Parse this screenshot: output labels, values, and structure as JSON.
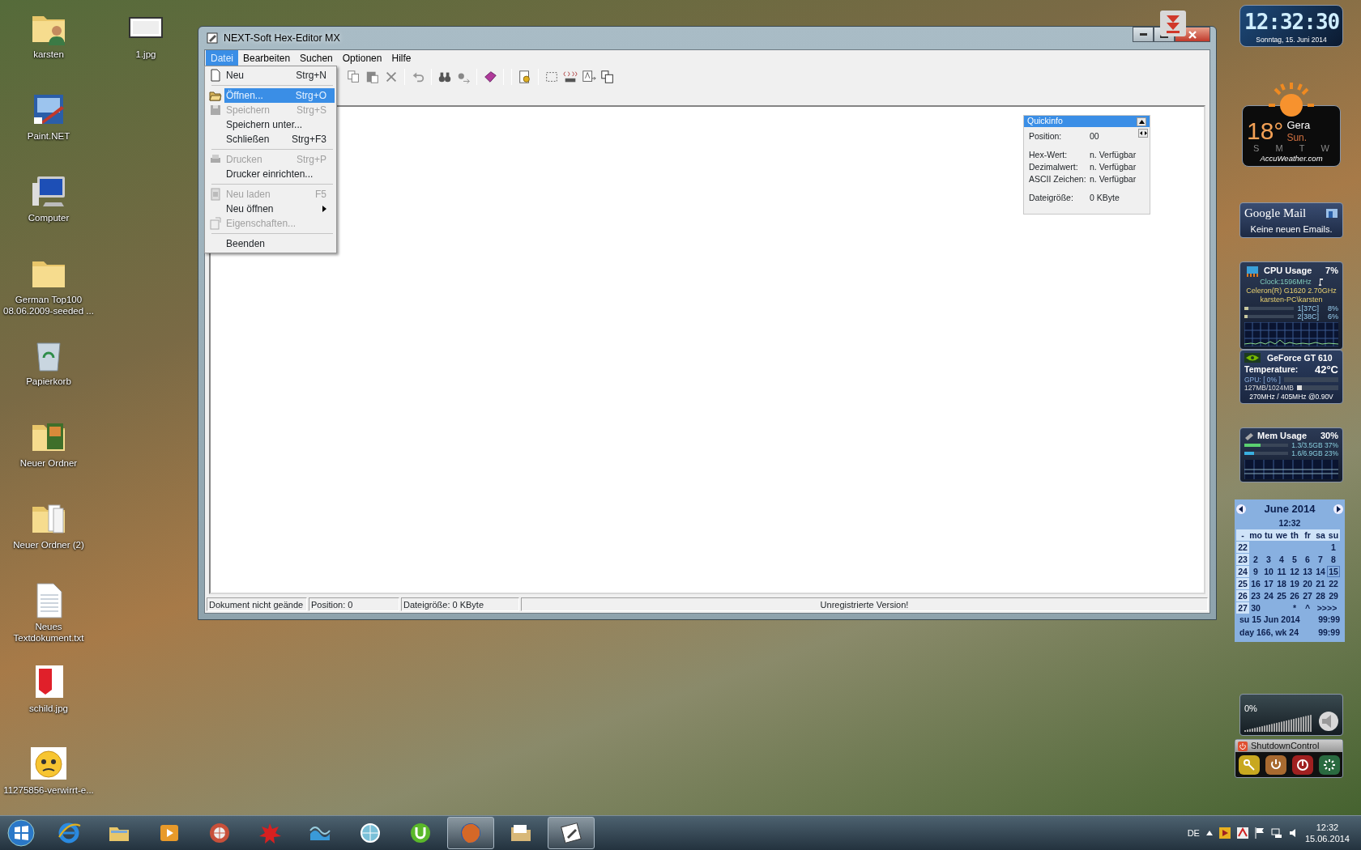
{
  "desktop_icons": [
    {
      "kind": "user-folder",
      "label": "karsten"
    },
    {
      "kind": "paint-app",
      "label": "Paint.NET"
    },
    {
      "kind": "computer",
      "label": "Computer"
    },
    {
      "kind": "folder",
      "label": "German Top100 08.06.2009-seeded ..."
    },
    {
      "kind": "recycle-bin",
      "label": "Papierkorb"
    },
    {
      "kind": "photo-folder",
      "label": "Neuer Ordner"
    },
    {
      "kind": "document-folder",
      "label": "Neuer Ordner (2)"
    },
    {
      "kind": "text-file",
      "label": "Neues Textdokument.txt"
    },
    {
      "kind": "image-file",
      "label": "schild.jpg"
    },
    {
      "kind": "emoji-image",
      "label": "11275856-verwirrt-e..."
    }
  ],
  "desktop_icons_column_2": [
    {
      "kind": "blank-image",
      "label": "1.jpg"
    }
  ],
  "window": {
    "title": "NEXT-Soft Hex-Editor MX",
    "menu": [
      {
        "label": "Datei",
        "selected": true
      },
      {
        "label": "Bearbeiten",
        "selected": false
      },
      {
        "label": "Suchen",
        "selected": false
      },
      {
        "label": "Optionen",
        "selected": false
      },
      {
        "label": "Hilfe",
        "selected": false
      }
    ],
    "file_menu": [
      {
        "kind": "item",
        "label": "Neu",
        "shortcut": "Strg+N",
        "disabled": false,
        "selected": false
      },
      {
        "kind": "separator"
      },
      {
        "kind": "item",
        "label": "Öffnen...",
        "shortcut": "Strg+O",
        "disabled": false,
        "selected": true
      },
      {
        "kind": "item",
        "label": "Speichern",
        "shortcut": "Strg+S",
        "disabled": true,
        "selected": false
      },
      {
        "kind": "item",
        "label": "Speichern unter...",
        "disabled": false,
        "selected": false
      },
      {
        "kind": "item",
        "label": "Schließen",
        "shortcut": "Strg+F3",
        "disabled": false,
        "selected": false
      },
      {
        "kind": "separator"
      },
      {
        "kind": "item",
        "label": "Drucken",
        "shortcut": "Strg+P",
        "disabled": true,
        "selected": false
      },
      {
        "kind": "item",
        "label": "Drucker einrichten...",
        "disabled": false,
        "selected": false
      },
      {
        "kind": "separator"
      },
      {
        "kind": "item",
        "label": "Neu laden",
        "shortcut": "F5",
        "disabled": true,
        "selected": false
      },
      {
        "kind": "submenu",
        "label": "Neu öffnen",
        "disabled": false,
        "selected": false
      },
      {
        "kind": "item",
        "label": "Eigenschaften...",
        "disabled": true,
        "selected": false
      },
      {
        "kind": "separator"
      },
      {
        "kind": "item",
        "label": "Beenden",
        "disabled": false,
        "selected": false
      }
    ],
    "quickinfo": {
      "title": "Quickinfo",
      "groups": [
        [
          {
            "label": "Position:",
            "value": "00"
          }
        ],
        [
          {
            "label": "Hex-Wert:",
            "value": "n. Verfügbar"
          },
          {
            "label": "Dezimalwert:",
            "value": "n. Verfügbar"
          },
          {
            "label": "ASCII Zeichen:",
            "value": "n. Verfügbar"
          }
        ],
        [
          {
            "label": "Dateigröße:",
            "value": "0 KByte"
          }
        ]
      ]
    },
    "status_bar": [
      {
        "text": "Dokument nicht geände"
      },
      {
        "text": "Position: 0"
      },
      {
        "text": "Dateigröße: 0 KByte"
      },
      {
        "text": "Unregistrierte Version!"
      }
    ]
  },
  "gadgets": {
    "clock": {
      "time": "12:32:30",
      "date": "Sonntag, 15. Juni 2014"
    },
    "weather": {
      "temperature": "18°",
      "city": "Gera",
      "day": "Sun.",
      "forecast_days": [
        "S",
        "M",
        "T",
        "W"
      ],
      "source": "AccuWeather.com"
    },
    "mail": {
      "title": "Google Mail",
      "message": "Keine neuen Emails."
    },
    "cpu": {
      "title": "CPU Usage",
      "usage": "7%",
      "clock": "Clock:1596MHz",
      "processor": "Celeron(R) G1620 2.70GHz",
      "user": "karsten-PC\\karsten",
      "cores": [
        {
          "label": "1[37C]",
          "value": "8%",
          "level": 0.08
        },
        {
          "label": "2[38C]",
          "value": "6%",
          "level": 0.06
        }
      ]
    },
    "gpu": {
      "title": "GeForce GT 610",
      "temperature_label": "Temperature:",
      "temperature": "42°C",
      "rows": [
        {
          "text": "GPU: [ 0% ]",
          "level": 0
        },
        {
          "text": "127MB/1024MB",
          "level": 0.12
        }
      ],
      "clocks": "270MHz / 405MHz @0.90V"
    },
    "memory": {
      "title": "Mem Usage",
      "usage": "30%",
      "rows": [
        {
          "text": "1.3/3.5GB 37%",
          "level": 0.37
        },
        {
          "text": "1.6/6.9GB 23%",
          "level": 0.23
        }
      ]
    },
    "calendar": {
      "month": "June 2014",
      "time": "12:32",
      "headers": [
        "-",
        "mo",
        "tu",
        "we",
        "th",
        "fr",
        "sa",
        "su"
      ],
      "weeks": [
        {
          "week": "22",
          "kind": "leading",
          "days": [
            {
              "t": "1",
              "today": false
            }
          ]
        },
        {
          "week": "23",
          "kind": "full",
          "days": [
            {
              "t": "2",
              "today": false
            },
            {
              "t": "3",
              "today": false
            },
            {
              "t": "4",
              "today": false
            },
            {
              "t": "5",
              "today": false
            },
            {
              "t": "6",
              "today": false
            },
            {
              "t": "7",
              "today": false
            },
            {
              "t": "8",
              "today": false
            }
          ]
        },
        {
          "week": "24",
          "kind": "full",
          "days": [
            {
              "t": "9",
              "today": false
            },
            {
              "t": "10",
              "today": false
            },
            {
              "t": "11",
              "today": false
            },
            {
              "t": "12",
              "today": false
            },
            {
              "t": "13",
              "today": false
            },
            {
              "t": "14",
              "today": false
            },
            {
              "t": "15",
              "today": true
            }
          ]
        },
        {
          "week": "25",
          "kind": "full",
          "days": [
            {
              "t": "16",
              "today": false
            },
            {
              "t": "17",
              "today": false
            },
            {
              "t": "18",
              "today": false
            },
            {
              "t": "19",
              "today": false
            },
            {
              "t": "20",
              "today": false
            },
            {
              "t": "21",
              "today": false
            },
            {
              "t": "22",
              "today": false
            }
          ]
        },
        {
          "week": "26",
          "kind": "full",
          "days": [
            {
              "t": "23",
              "today": false
            },
            {
              "t": "24",
              "today": false
            },
            {
              "t": "25",
              "today": false
            },
            {
              "t": "26",
              "today": false
            },
            {
              "t": "27",
              "today": false
            },
            {
              "t": "28",
              "today": false
            },
            {
              "t": "29",
              "today": false
            }
          ]
        },
        {
          "week": "27",
          "kind": "trailing",
          "days": [
            {
              "t": "30",
              "today": false
            }
          ],
          "links": [
            "*",
            "^",
            ">>>>"
          ]
        }
      ],
      "footer": [
        {
          "left": "su 15 Jun 2014",
          "right": "99:99"
        },
        {
          "left": "day 166, wk 24",
          "right": "99:99"
        }
      ]
    },
    "volume": {
      "reading": "0%"
    },
    "shutdown": {
      "title": "ShutdownControl"
    }
  },
  "taskbar": {
    "buttons": [
      {
        "kind": "internet-explorer",
        "running": false
      },
      {
        "kind": "file-explorer",
        "running": false
      },
      {
        "kind": "media-player",
        "running": false
      },
      {
        "kind": "globe-app",
        "running": false
      },
      {
        "kind": "splat-app",
        "running": false
      },
      {
        "kind": "wave-app",
        "running": false
      },
      {
        "kind": "sphere-app",
        "running": false
      },
      {
        "kind": "torrent-app",
        "running": false
      },
      {
        "kind": "firefox",
        "running": true
      },
      {
        "kind": "folder-app",
        "running": false
      },
      {
        "kind": "hex-editor",
        "running": true
      }
    ],
    "language": "DE",
    "time": "12:32",
    "date": "15.06.2014"
  }
}
